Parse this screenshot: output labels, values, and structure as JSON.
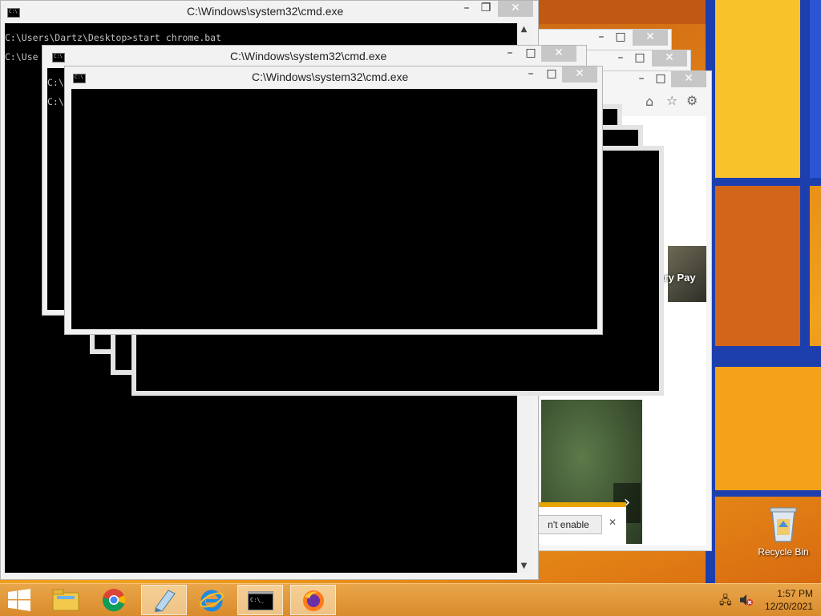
{
  "desktop": {
    "recycle_bin_label": "Recycle Bin"
  },
  "cmd_windows": [
    {
      "title": "C:\\Windows\\system32\\cmd.exe",
      "lines": [
        "C:\\Users\\Dartz\\Desktop>start chrome.bat",
        "C:\\Use"
      ]
    },
    {
      "title": "C:\\Windows\\system32\\cmd.exe",
      "lines": [
        "C:\\",
        "C:\\"
      ]
    },
    {
      "title": "C:\\Windows\\system32\\cmd.exe",
      "lines": []
    }
  ],
  "browser": {
    "page_text": "tary Pay",
    "notification_button": "n't enable",
    "notification_close": "✕"
  },
  "window_controls": {
    "minimize": "–",
    "maximize": "□",
    "restore": "❐",
    "close": "✕"
  },
  "taskbar": {
    "time": "1:57 PM",
    "date": "12/20/2021"
  },
  "colors": {
    "accent_blue": "#1d3fae",
    "taskbar": "#e0982f",
    "console_bg": "#000000"
  }
}
